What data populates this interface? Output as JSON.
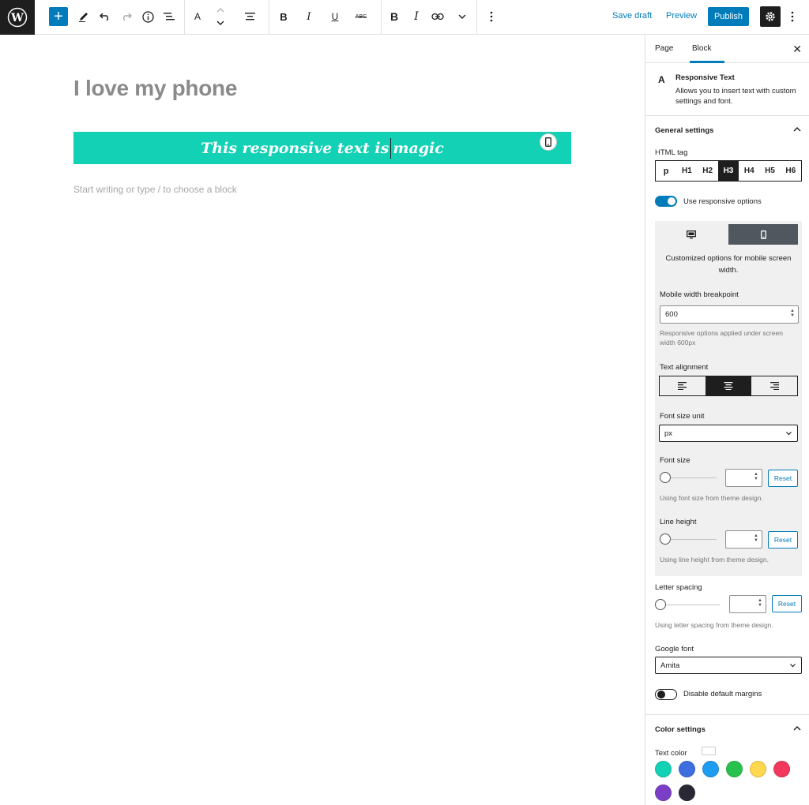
{
  "toolbar": {
    "save_draft": "Save draft",
    "preview": "Preview",
    "publish": "Publish",
    "icons": [
      "wordpress-icon",
      "plus-icon",
      "pencil-icon",
      "undo-icon",
      "redo-icon",
      "info-icon",
      "list-view-icon",
      "font-a-icon",
      "align-center-icon",
      "bold-icon",
      "italic-icon",
      "underline-icon",
      "strikethrough-icon",
      "bold-icon",
      "italic-icon",
      "link-icon",
      "chevron-down-icon",
      "more-vertical-icon",
      "gear-icon"
    ]
  },
  "editor": {
    "post_title": "I love my phone",
    "responsive_text_before": "This responsive text is",
    "responsive_text_after": "magic",
    "block_bg": "#12d1b4",
    "placeholder": "Start writing or type / to choose a block"
  },
  "sidebar": {
    "tabs": [
      "Page",
      "Block"
    ],
    "block_icon": "A",
    "block_title": "Responsive Text",
    "block_desc": "Allows you to insert text with custom settings and font.",
    "general_settings": "General settings",
    "html_tag_label": "HTML tag",
    "html_tags": [
      "p",
      "H1",
      "H2",
      "H3",
      "H4",
      "H5",
      "H6"
    ],
    "html_tag_selected": "H3",
    "use_responsive": "Use responsive options",
    "responsive_desc": "Customized options for mobile screen width.",
    "mobile_breakpoint_label": "Mobile width breakpoint",
    "mobile_breakpoint_value": "600",
    "breakpoint_help": "Responsive options applied under screen width 600px",
    "text_alignment_label": "Text alignment",
    "font_size_unit_label": "Font size unit",
    "font_size_unit_value": "px",
    "font_size_label": "Font size",
    "font_size_help": "Using font size from theme design.",
    "line_height_label": "Line height",
    "line_height_help": "Using line height from theme design.",
    "letter_spacing_label": "Letter spacing",
    "letter_spacing_help": "Using letter spacing from theme design.",
    "reset": "Reset",
    "google_font_label": "Google font",
    "google_font_value": "Amita",
    "disable_margins": "Disable default margins",
    "color_settings": "Color settings",
    "text_color_label": "Text color",
    "swatches": [
      "#12d1b4",
      "#3c6ee0",
      "#1e9cf0",
      "#27c24c",
      "#ffd84f",
      "#f2385c",
      "#7a3fc6",
      "#2b2836"
    ]
  }
}
